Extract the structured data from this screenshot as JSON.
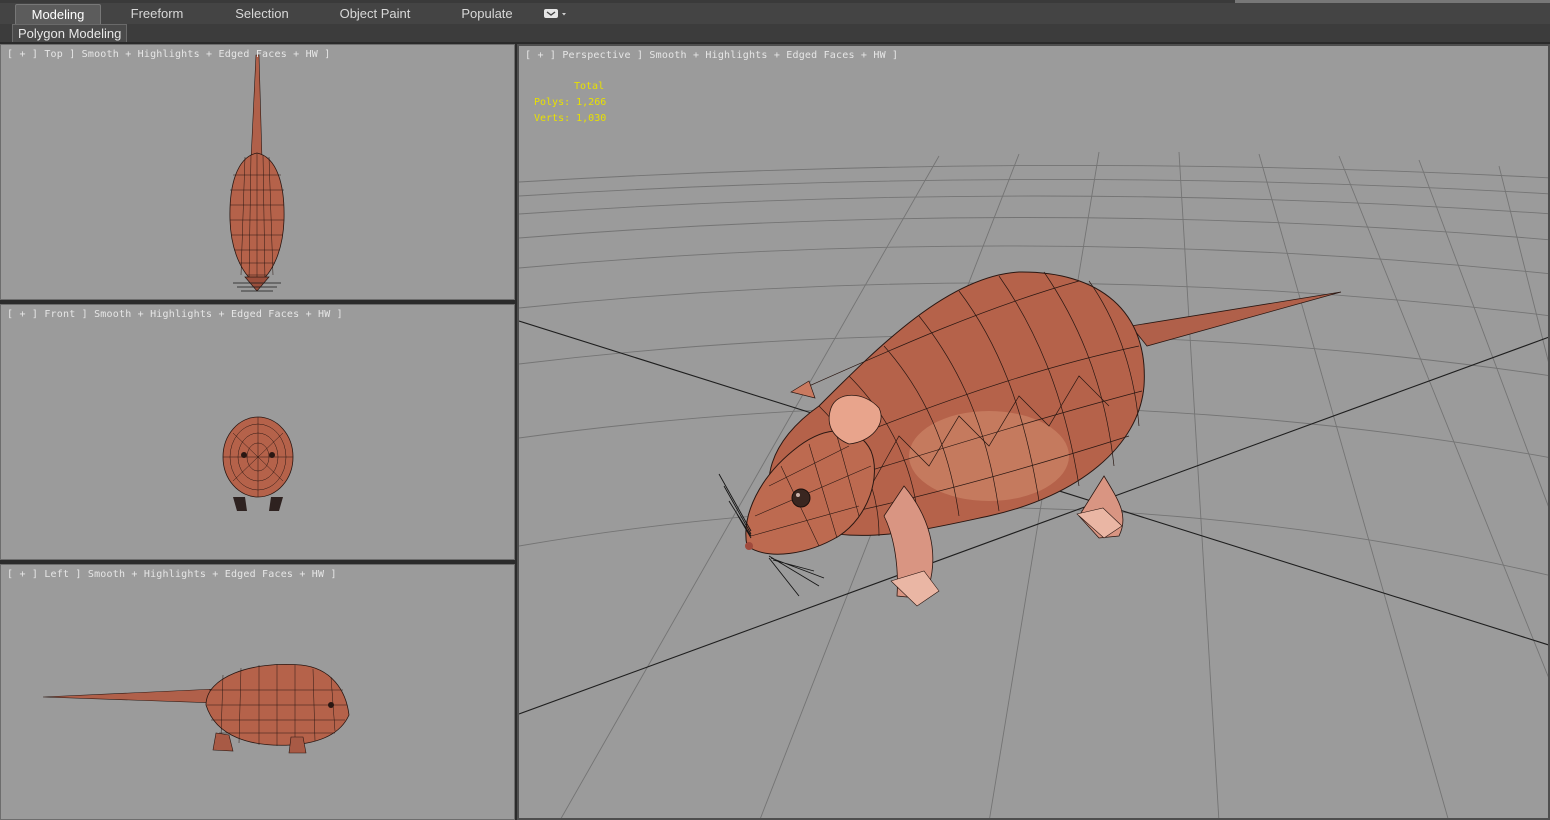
{
  "ribbon": {
    "tabs": [
      {
        "label": "Modeling",
        "active": true
      },
      {
        "label": "Freeform",
        "active": false
      },
      {
        "label": "Selection",
        "active": false
      },
      {
        "label": "Object Paint",
        "active": false
      },
      {
        "label": "Populate",
        "active": false
      }
    ],
    "more_icon": "dropdown-toggle-icon"
  },
  "panel": {
    "label": "Polygon Modeling"
  },
  "viewports": {
    "top": {
      "label": "[ + ] Top ] Smooth + Highlights + Edged Faces + HW ]"
    },
    "front": {
      "label": "[ + ] Front ] Smooth + Highlights + Edged Faces + HW ]"
    },
    "left": {
      "label": "[ + ] Left ] Smooth + Highlights + Edged Faces + HW ]"
    },
    "perspective": {
      "label": "[ + ] Perspective ] Smooth + Highlights + Edged Faces + HW ]",
      "stats": {
        "header": "Total",
        "polys": "Polys: 1,266",
        "verts": "Verts: 1,030"
      }
    }
  },
  "colors": {
    "viewport_bg": "#9b9b9b",
    "stats_text": "#e8e000",
    "model_fill": "#b5624a",
    "wire": "#2a1712"
  }
}
